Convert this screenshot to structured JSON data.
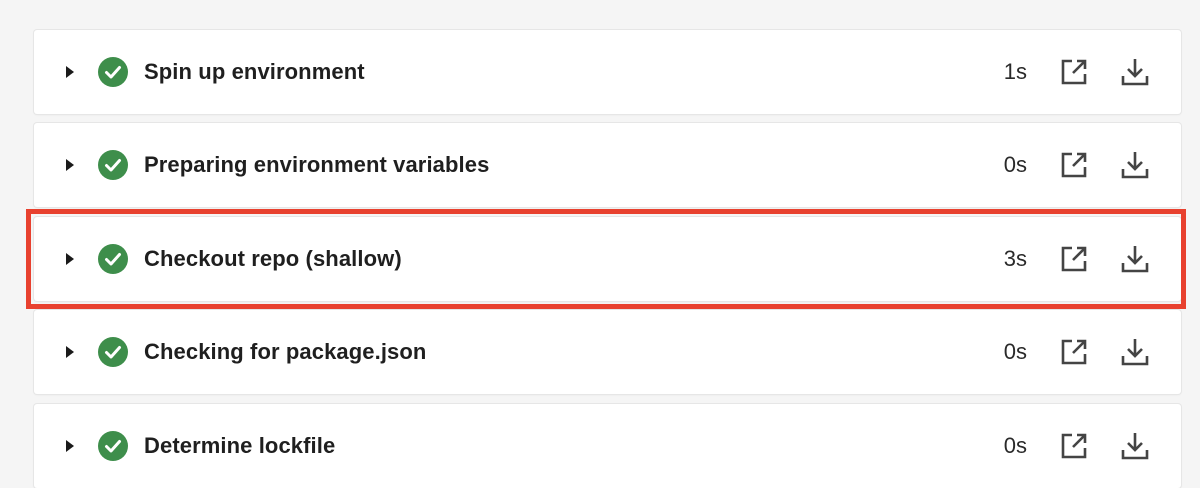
{
  "colors": {
    "background": "#f5f5f5",
    "card": "#ffffff",
    "success": "#3e8e4b",
    "highlight_border": "#e8412f",
    "text": "#1f1f1f",
    "icon": "#444444"
  },
  "icons": {
    "expand": "caret-right-icon",
    "status": "check-circle-icon",
    "open": "external-link-icon",
    "download": "download-icon"
  },
  "steps": [
    {
      "name": "Spin up environment",
      "duration": "1s",
      "status": "success"
    },
    {
      "name": "Preparing environment variables",
      "duration": "0s",
      "status": "success"
    },
    {
      "name": "Checkout repo (shallow)",
      "duration": "3s",
      "status": "success",
      "highlighted": true
    },
    {
      "name": "Checking for package.json",
      "duration": "0s",
      "status": "success"
    },
    {
      "name": "Determine lockfile",
      "duration": "0s",
      "status": "success"
    }
  ]
}
